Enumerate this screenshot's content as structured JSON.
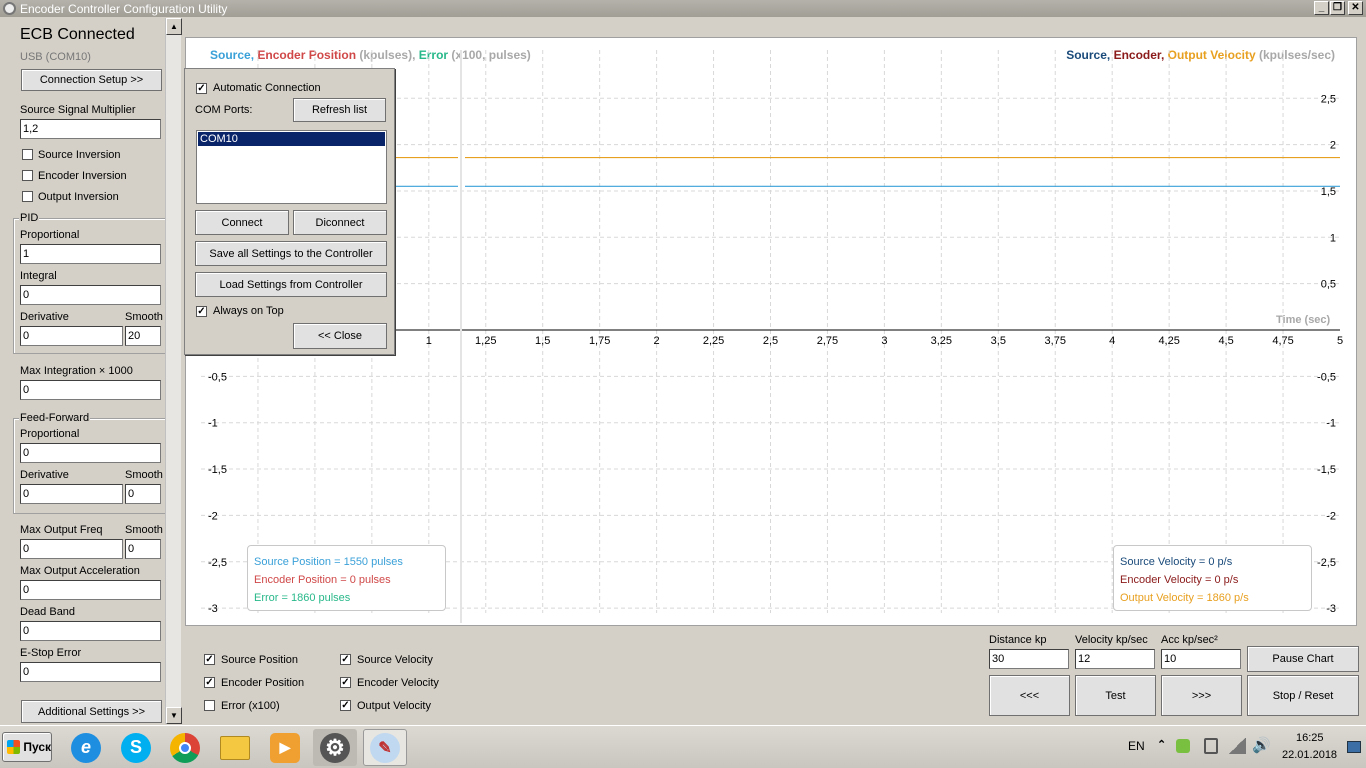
{
  "window": {
    "title": "Encoder Controller Configuration Utility"
  },
  "sidebar": {
    "status": "ECB Connected",
    "port": "USB (COM10)",
    "connection_setup": "Connection Setup >>",
    "source_multiplier_label": "Source Signal Multiplier",
    "source_multiplier_value": "1,2",
    "source_inversion": "Source Inversion",
    "encoder_inversion": "Encoder Inversion",
    "output_inversion": "Output Inversion",
    "pid": {
      "title": "PID",
      "proportional_label": "Proportional",
      "proportional_value": "1",
      "integral_label": "Integral",
      "integral_value": "0",
      "derivative_label": "Derivative",
      "derivative_value": "0",
      "smooth_label": "Smooth",
      "smooth_value": "20"
    },
    "max_integration_label": "Max Integration × 1000",
    "max_integration_value": "0",
    "ff": {
      "title": "Feed-Forward",
      "proportional_label": "Proportional",
      "proportional_value": "0",
      "derivative_label": "Derivative",
      "derivative_value": "0",
      "smooth_label": "Smooth",
      "smooth_value": "0"
    },
    "max_output_freq_label": "Max Output Freq",
    "max_output_freq_value": "0",
    "max_output_freq_smooth_label": "Smooth",
    "max_output_freq_smooth_value": "0",
    "max_output_acc_label": "Max Output Acceleration",
    "max_output_acc_value": "0",
    "dead_band_label": "Dead Band",
    "dead_band_value": "0",
    "estop_label": "E-Stop Error",
    "estop_value": "0",
    "additional_settings": "Additional Settings >>"
  },
  "popup": {
    "auto_connection": "Automatic Connection",
    "com_ports_label": "COM Ports:",
    "refresh": "Refresh list",
    "ports": [
      "COM10"
    ],
    "connect": "Connect",
    "disconnect": "Diconnect",
    "save_all": "Save all Settings to the Controller",
    "load": "Load Settings from Controller",
    "always_on_top": "Always on Top",
    "close": "<< Close"
  },
  "chart_header": {
    "left": {
      "source": "Source",
      "sep1": ", ",
      "encoder": "Encoder Position",
      "unit1": " (kpulses), ",
      "error": "Error",
      "unit2": " (x100, pulses)"
    },
    "right": {
      "source": "Source",
      "sep1": ", ",
      "encoder": "Encoder",
      "sep2": ", ",
      "output": "Output Velocity",
      "unit": " (kpulses/sec)"
    },
    "time_label": "Time (sec)"
  },
  "chart_data": {
    "type": "line",
    "xlabel": "Time (sec)",
    "xlim": [
      0,
      5
    ],
    "ylim": [
      -3,
      3
    ],
    "x_ticks": [
      "1",
      "1,25",
      "1,5",
      "1,75",
      "2",
      "2,25",
      "2,5",
      "2,75",
      "3",
      "3,25",
      "3,5",
      "3,75",
      "4",
      "4,25",
      "4,5",
      "4,75",
      "5"
    ],
    "y_ticks_left": [
      "-0,5",
      "-1",
      "-1,5",
      "-2",
      "-2,5",
      "-3"
    ],
    "y_ticks_right": [
      "2,5",
      "2",
      "1,5",
      "1",
      "0,5",
      "-0,5",
      "-1",
      "-1,5",
      "-2",
      "-2,5",
      "-3"
    ],
    "grid": true,
    "series": [
      {
        "name": "Output Velocity",
        "color": "#e8a020",
        "value": 1.86
      },
      {
        "name": "Source",
        "color": "#3aa0d8",
        "value": 1.55
      }
    ]
  },
  "legend_left": {
    "source": "Source Position = 1550 pulses",
    "encoder": "Encoder Position = 0 pulses",
    "error": "Error = 1860 pulses"
  },
  "legend_right": {
    "source": "Source Velocity = 0 p/s",
    "encoder": "Encoder Velocity = 0 p/s",
    "output": "Output Velocity = 1860 p/s"
  },
  "bottom": {
    "source_position": "Source Position",
    "encoder_position": "Encoder Position",
    "error": "Error (x100)",
    "source_velocity": "Source Velocity",
    "encoder_velocity": "Encoder Velocity",
    "output_velocity": "Output Velocity",
    "distance_label": "Distance kp",
    "distance_value": "30",
    "velocity_label": "Velocity kp/sec",
    "velocity_value": "12",
    "acc_label": "Acc  kp/sec²",
    "acc_value": "10",
    "pause": "Pause Chart",
    "back": "<<<",
    "test": "Test",
    "forward": ">>>",
    "stop": "Stop / Reset"
  },
  "taskbar": {
    "start": "Пуск",
    "lang": "EN",
    "time": "16:25",
    "date": "22.01.2018"
  },
  "colors": {
    "source": "#3aa0d8",
    "encoder": "#d04848",
    "error": "#28b88a",
    "source_vel": "#1a4a7a",
    "encoder_vel": "#8b1a1a",
    "output_vel": "#e8a020",
    "muted": "#a8a8a8"
  }
}
